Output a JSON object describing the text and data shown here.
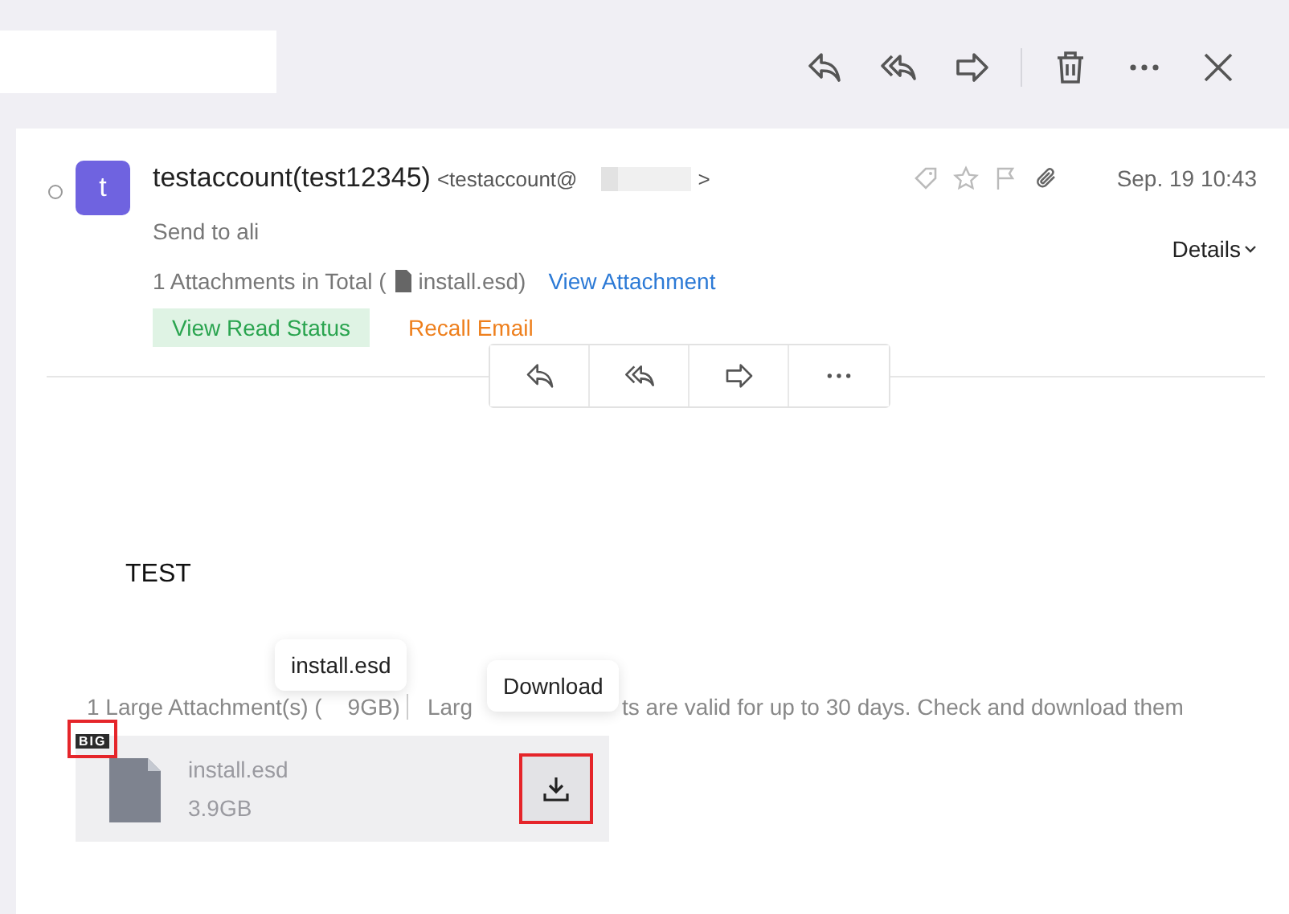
{
  "toolbar": {
    "actions": [
      {
        "kind": "reply"
      },
      {
        "kind": "reply-all"
      },
      {
        "kind": "forward"
      },
      {
        "kind": "divider"
      },
      {
        "kind": "delete"
      },
      {
        "kind": "more"
      },
      {
        "kind": "close"
      }
    ]
  },
  "message": {
    "avatar": "t",
    "unread": true,
    "sender_name": "testaccount(test12345)",
    "sender_email": "<testaccount@",
    "sender_email_end": ">",
    "date": "Sep. 19 10:43",
    "recipients": "Send to ali",
    "details": "Details",
    "attachments_summary_start": "1 Attachments in Total (",
    "attachments_summary_file": "install.esd)",
    "view_attachment": "View Attachment",
    "read_status": "View Read Status",
    "recall": "Recall Email",
    "quick_actions": [
      {
        "kind": "reply"
      },
      {
        "kind": "reply-all"
      },
      {
        "kind": "forward"
      },
      {
        "kind": "more"
      }
    ],
    "body": "TEST",
    "notice_parts": [
      "1 Large Attachment(s) (",
      "9GB)",
      "Larg",
      "ts are valid for up to 30 days. Check and download them"
    ],
    "large_attachment": {
      "badge": "BIG",
      "name": "install.esd",
      "size": "3.9GB",
      "highlighted": true
    },
    "tooltips": [
      "install.esd",
      "Download"
    ]
  }
}
